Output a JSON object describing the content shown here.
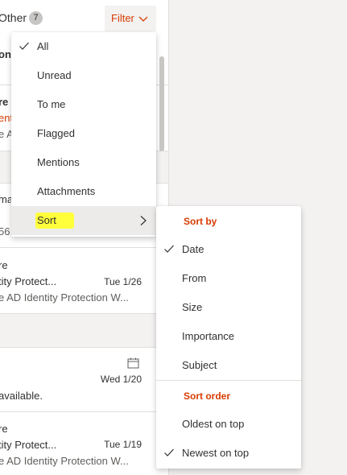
{
  "top_bar": {
    "other_tab_label": "Other",
    "other_count": "7",
    "filter_label": "Filter"
  },
  "mail_list": {
    "items": [
      {
        "lines": [
          "onv"
        ]
      },
      {
        "lines": [
          "re",
          "enti",
          "e A"
        ]
      },
      {
        "lines": [
          "ma",
          "56"
        ]
      },
      {
        "lines": [
          "re",
          "tity Protect...",
          "e AD Identity Protection W..."
        ],
        "date": "Tue 1/26"
      },
      {
        "lines": [
          "",
          "available."
        ],
        "date": "Wed 1/20"
      },
      {
        "lines": [
          "re",
          "tity Protect...",
          "e AD Identity Protection W..."
        ],
        "date": "Tue 1/19"
      }
    ]
  },
  "filter_menu": {
    "items": [
      {
        "label": "All",
        "checked": true
      },
      {
        "label": "Unread",
        "checked": false
      },
      {
        "label": "To me",
        "checked": false
      },
      {
        "label": "Flagged",
        "checked": false
      },
      {
        "label": "Mentions",
        "checked": false
      },
      {
        "label": "Attachments",
        "checked": false
      },
      {
        "label": "Sort",
        "checked": false,
        "has_submenu": true
      }
    ],
    "highlight_color": "#ffff3c"
  },
  "sort_menu": {
    "sort_by_header": "Sort by",
    "sort_by_items": [
      {
        "label": "Date",
        "checked": true
      },
      {
        "label": "From",
        "checked": false
      },
      {
        "label": "Size",
        "checked": false
      },
      {
        "label": "Importance",
        "checked": false
      },
      {
        "label": "Subject",
        "checked": false
      }
    ],
    "sort_order_header": "Sort order",
    "sort_order_items": [
      {
        "label": "Oldest on top",
        "checked": false
      },
      {
        "label": "Newest on top",
        "checked": true
      }
    ]
  },
  "colors": {
    "accent": "#d83b01",
    "menu_hover": "#edebe9",
    "pane_bg": "#f3f2f1"
  },
  "icons": {
    "check": "check-icon",
    "filter_chevron": "chevron-down-icon",
    "submenu": "chevron-right-icon",
    "calendar": "calendar-icon"
  }
}
